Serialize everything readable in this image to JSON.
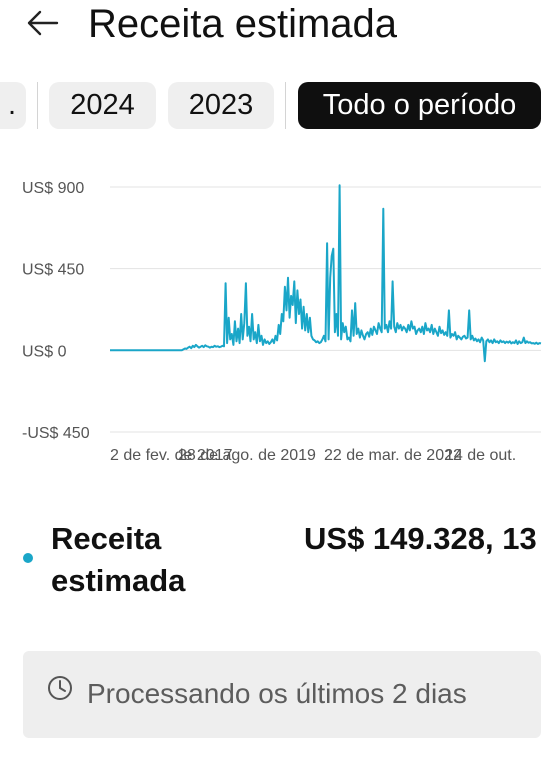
{
  "header": {
    "back_icon": "arrow-left-icon",
    "title": "Receita estimada"
  },
  "period_chips": {
    "partial_label": ".",
    "items": [
      {
        "label": "2024",
        "selected": false
      },
      {
        "label": "2023",
        "selected": false
      },
      {
        "label": "Todo o período",
        "selected": true
      }
    ]
  },
  "chart_data": {
    "type": "line",
    "title": "",
    "xlabel": "",
    "ylabel": "",
    "y_ticks": [
      "US$ 900",
      "US$ 450",
      "US$ 0",
      "-US$ 450"
    ],
    "ylim": [
      -450,
      900
    ],
    "x_ticks": [
      "2 de fev. de 2017",
      "28 de ago. de 2019",
      "22 de mar. de 2022",
      "14 de out."
    ],
    "color": "#1aa6c8",
    "grid": true,
    "series": [
      {
        "values": [
          0,
          0,
          0,
          0,
          0,
          0,
          0,
          0,
          0,
          0,
          0,
          0,
          0,
          0,
          0,
          0,
          0,
          0,
          0,
          0,
          0,
          0,
          0,
          0,
          0,
          0,
          0,
          0,
          0,
          0,
          0,
          0,
          0,
          0,
          0,
          0,
          0,
          0,
          0,
          0,
          0,
          0,
          0,
          0,
          0,
          0,
          0,
          5,
          10,
          8,
          15,
          20,
          12,
          25,
          18,
          30,
          22,
          15,
          20,
          25,
          18,
          28,
          22,
          20,
          15,
          20,
          18,
          25,
          20,
          22,
          18,
          20,
          25,
          22,
          370,
          40,
          180,
          60,
          90,
          30,
          160,
          50,
          120,
          40,
          200,
          60,
          150,
          370,
          80,
          130,
          50,
          200,
          60,
          100,
          40,
          140,
          50,
          80,
          30,
          60,
          40,
          50,
          35,
          45,
          60,
          40,
          80,
          55,
          140,
          90,
          200,
          160,
          350,
          220,
          400,
          180,
          300,
          250,
          380,
          150,
          330,
          200,
          280,
          120,
          240,
          110,
          200,
          100,
          180,
          80,
          60,
          55,
          45,
          50,
          40,
          45,
          60,
          80,
          50,
          590,
          60,
          400,
          520,
          560,
          100,
          200,
          80,
          910,
          60,
          150,
          100,
          130,
          60,
          70,
          50,
          220,
          80,
          260,
          90,
          120,
          70,
          110,
          80,
          60,
          90,
          100,
          75,
          120,
          85,
          130,
          110,
          90,
          150,
          120,
          100,
          780,
          120,
          140,
          100,
          160,
          120,
          380,
          130,
          100,
          150,
          120,
          140,
          110,
          130,
          120,
          100,
          140,
          110,
          160,
          120,
          130,
          90,
          110,
          120,
          100,
          130,
          90,
          150,
          110,
          120,
          100,
          140,
          90,
          120,
          100,
          80,
          130,
          95,
          110,
          85,
          100,
          80,
          220,
          70,
          90,
          80,
          100,
          60,
          80,
          70,
          60,
          75,
          80,
          65,
          70,
          220,
          60,
          80,
          55,
          65,
          50,
          60,
          45,
          70,
          55,
          -60,
          50,
          60,
          45,
          55,
          40,
          60,
          45,
          50,
          40,
          55,
          45,
          50,
          40,
          48,
          42,
          50,
          38,
          45,
          40,
          55,
          35,
          50,
          40,
          45,
          70,
          40,
          50,
          42,
          45,
          38,
          40,
          36,
          42,
          35,
          40,
          38
        ]
      }
    ]
  },
  "metric": {
    "label": "Receita estimada",
    "value": "US$ 149.328, 13",
    "dot_color": "#1aa6c8"
  },
  "notice": {
    "icon": "clock-icon",
    "text": "Processando os últimos 2 dias"
  }
}
